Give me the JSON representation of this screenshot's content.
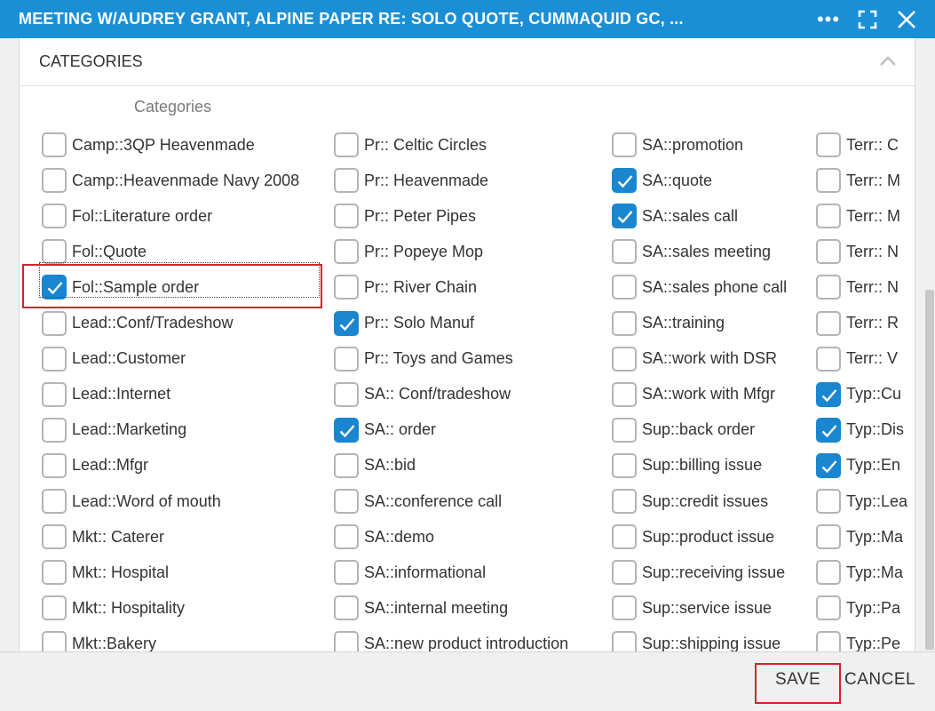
{
  "window": {
    "title": "MEETING W/AUDREY GRANT, ALPINE PAPER RE: SOLO QUOTE, CUMMAQUID GC, ...",
    "icons": [
      "more-options-icon",
      "expand-icon",
      "close-icon"
    ]
  },
  "section": {
    "title": "CATEGORIES",
    "field_label": "Categories"
  },
  "columns": [
    {
      "items": [
        {
          "label": "Camp::3QP Heavenmade",
          "checked": false
        },
        {
          "label": "Camp::Heavenmade Navy 2008",
          "checked": false
        },
        {
          "label": "Fol::Literature order",
          "checked": false
        },
        {
          "label": "Fol::Quote",
          "checked": false
        },
        {
          "label": "Fol::Sample order",
          "checked": true,
          "focused": true
        },
        {
          "label": "Lead::Conf/Tradeshow",
          "checked": false
        },
        {
          "label": "Lead::Customer",
          "checked": false
        },
        {
          "label": "Lead::Internet",
          "checked": false
        },
        {
          "label": "Lead::Marketing",
          "checked": false
        },
        {
          "label": "Lead::Mfgr",
          "checked": false
        },
        {
          "label": "Lead::Word of mouth",
          "checked": false
        },
        {
          "label": "Mkt:: Caterer",
          "checked": false
        },
        {
          "label": "Mkt:: Hospital",
          "checked": false
        },
        {
          "label": "Mkt:: Hospitality",
          "checked": false
        },
        {
          "label": "Mkt::Bakery",
          "checked": false
        }
      ]
    },
    {
      "items": [
        {
          "label": "Pr:: Celtic Circles",
          "checked": false
        },
        {
          "label": "Pr:: Heavenmade",
          "checked": false
        },
        {
          "label": "Pr:: Peter Pipes",
          "checked": false
        },
        {
          "label": "Pr:: Popeye Mop",
          "checked": false
        },
        {
          "label": "Pr:: River Chain",
          "checked": false
        },
        {
          "label": "Pr:: Solo Manuf",
          "checked": true
        },
        {
          "label": "Pr:: Toys and Games",
          "checked": false
        },
        {
          "label": "SA:: Conf/tradeshow",
          "checked": false
        },
        {
          "label": "SA:: order",
          "checked": true
        },
        {
          "label": "SA::bid",
          "checked": false
        },
        {
          "label": "SA::conference call",
          "checked": false
        },
        {
          "label": "SA::demo",
          "checked": false
        },
        {
          "label": "SA::informational",
          "checked": false
        },
        {
          "label": "SA::internal meeting",
          "checked": false
        },
        {
          "label": "SA::new product introduction",
          "checked": false
        }
      ]
    },
    {
      "items": [
        {
          "label": "SA::promotion",
          "checked": false
        },
        {
          "label": "SA::quote",
          "checked": true
        },
        {
          "label": "SA::sales call",
          "checked": true
        },
        {
          "label": "SA::sales meeting",
          "checked": false
        },
        {
          "label": "SA::sales phone call",
          "checked": false
        },
        {
          "label": "SA::training",
          "checked": false
        },
        {
          "label": "SA::work with DSR",
          "checked": false
        },
        {
          "label": "SA::work with Mfgr",
          "checked": false
        },
        {
          "label": "Sup::back order",
          "checked": false
        },
        {
          "label": "Sup::billing issue",
          "checked": false
        },
        {
          "label": "Sup::credit issues",
          "checked": false
        },
        {
          "label": "Sup::product issue",
          "checked": false
        },
        {
          "label": "Sup::receiving issue",
          "checked": false
        },
        {
          "label": "Sup::service issue",
          "checked": false
        },
        {
          "label": "Sup::shipping issue",
          "checked": false
        }
      ]
    },
    {
      "items": [
        {
          "label": "Terr:: C",
          "checked": false
        },
        {
          "label": "Terr:: M",
          "checked": false
        },
        {
          "label": "Terr:: M",
          "checked": false
        },
        {
          "label": "Terr:: N",
          "checked": false
        },
        {
          "label": "Terr:: N",
          "checked": false
        },
        {
          "label": "Terr:: R",
          "checked": false
        },
        {
          "label": "Terr:: V",
          "checked": false
        },
        {
          "label": "Typ::Cu",
          "checked": true
        },
        {
          "label": "Typ::Dis",
          "checked": true
        },
        {
          "label": "Typ::En",
          "checked": true
        },
        {
          "label": "Typ::Lea",
          "checked": false
        },
        {
          "label": "Typ::Ma",
          "checked": false
        },
        {
          "label": "Typ::Ma",
          "checked": false
        },
        {
          "label": "Typ::Pa",
          "checked": false
        },
        {
          "label": "Typ::Pe",
          "checked": false
        }
      ]
    }
  ],
  "footer": {
    "save_label": "SAVE",
    "cancel_label": "CANCEL"
  },
  "colors": {
    "titlebar": "#1a8fd6",
    "checked": "#1a86cf",
    "annotation": "#d9202b"
  }
}
